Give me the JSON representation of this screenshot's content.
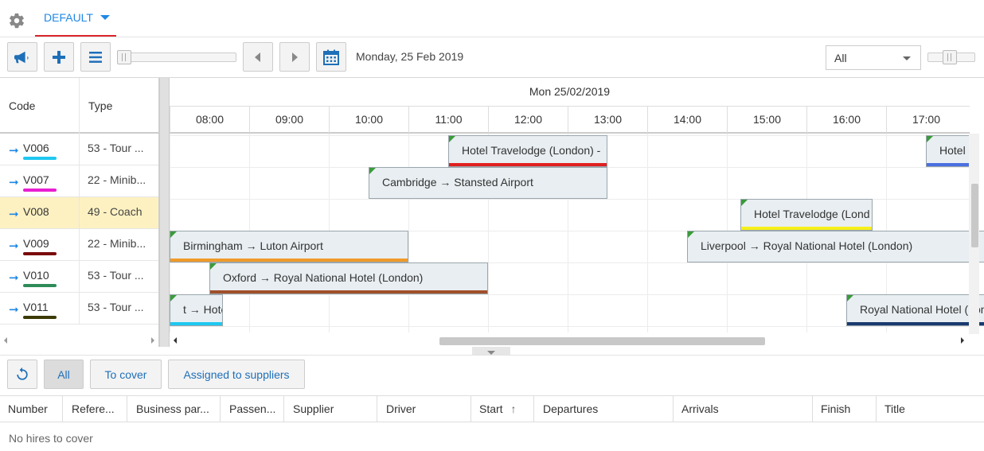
{
  "topbar": {
    "layout_tab": "DEFAULT"
  },
  "toolbar": {
    "date_label": "Monday, 25 Feb 2019",
    "vehicle_filter": "All"
  },
  "left_grid": {
    "columns": [
      "Code",
      "Type"
    ],
    "rows": [
      {
        "code": "V006",
        "type": "53 - Tour ...",
        "color": "#1ec8f0",
        "selected": false
      },
      {
        "code": "V007",
        "type": "22 - Minib...",
        "color": "#e81ed2",
        "selected": false
      },
      {
        "code": "V008",
        "type": "49 - Coach",
        "color": "",
        "selected": true
      },
      {
        "code": "V009",
        "type": "22 - Minib...",
        "color": "#7a0a0a",
        "selected": false
      },
      {
        "code": "V010",
        "type": "53 - Tour ...",
        "color": "#2e8b57",
        "selected": false
      },
      {
        "code": "V011",
        "type": "53 - Tour ...",
        "color": "#3b3a05",
        "selected": false
      }
    ]
  },
  "timeline": {
    "day_label": "Mon 25/02/2019",
    "hours": [
      "08:00",
      "09:00",
      "10:00",
      "11:00",
      "12:00",
      "13:00",
      "14:00",
      "15:00",
      "16:00",
      "17:00"
    ],
    "events": [
      {
        "label": "Hotel Travelodge (London) -",
        "row": 0,
        "start_hour": 11.0,
        "end_hour": 13.0,
        "color": "#e02020"
      },
      {
        "label": "Hotel",
        "row": 0,
        "start_hour": 17.0,
        "end_hour": 17.55,
        "color": "#4a6fe0"
      },
      {
        "label": "Cambridge → Stansted Airport",
        "row": 1,
        "start_hour": 10.0,
        "end_hour": 13.0,
        "color": ""
      },
      {
        "label": "Hotel Travelodge (Lond",
        "row": 2,
        "start_hour": 14.67,
        "end_hour": 16.33,
        "color": "#f5ef1a"
      },
      {
        "label": "Birmingham → Luton Airport",
        "row": 3,
        "start_hour": 7.5,
        "end_hour": 10.5,
        "color": "#f09a2a"
      },
      {
        "label": "Liverpool → Royal National Hotel (London)",
        "row": 3,
        "start_hour": 14.0,
        "end_hour": 18.0,
        "color": ""
      },
      {
        "label": "Oxford → Royal National Hotel (London)",
        "row": 4,
        "start_hour": 8.0,
        "end_hour": 11.5,
        "color": "#a0502a"
      },
      {
        "label": "t → Hotel T",
        "row": 5,
        "start_hour": 7.5,
        "end_hour": 8.17,
        "color": "#1ec8f0"
      },
      {
        "label": "Royal National Hotel (London",
        "row": 5,
        "start_hour": 16.0,
        "end_hour": 18.0,
        "color": "#1a3a70"
      }
    ]
  },
  "bottom": {
    "filters": [
      "All",
      "To cover",
      "Assigned to suppliers"
    ],
    "active_filter": "All",
    "columns": [
      "Number",
      "Refere...",
      "Business par...",
      "Passen...",
      "Supplier",
      "Driver",
      "Start",
      "Departures",
      "Arrivals",
      "Finish",
      "Title"
    ],
    "sort_indicator": "↑",
    "empty_message": "No hires to cover"
  }
}
